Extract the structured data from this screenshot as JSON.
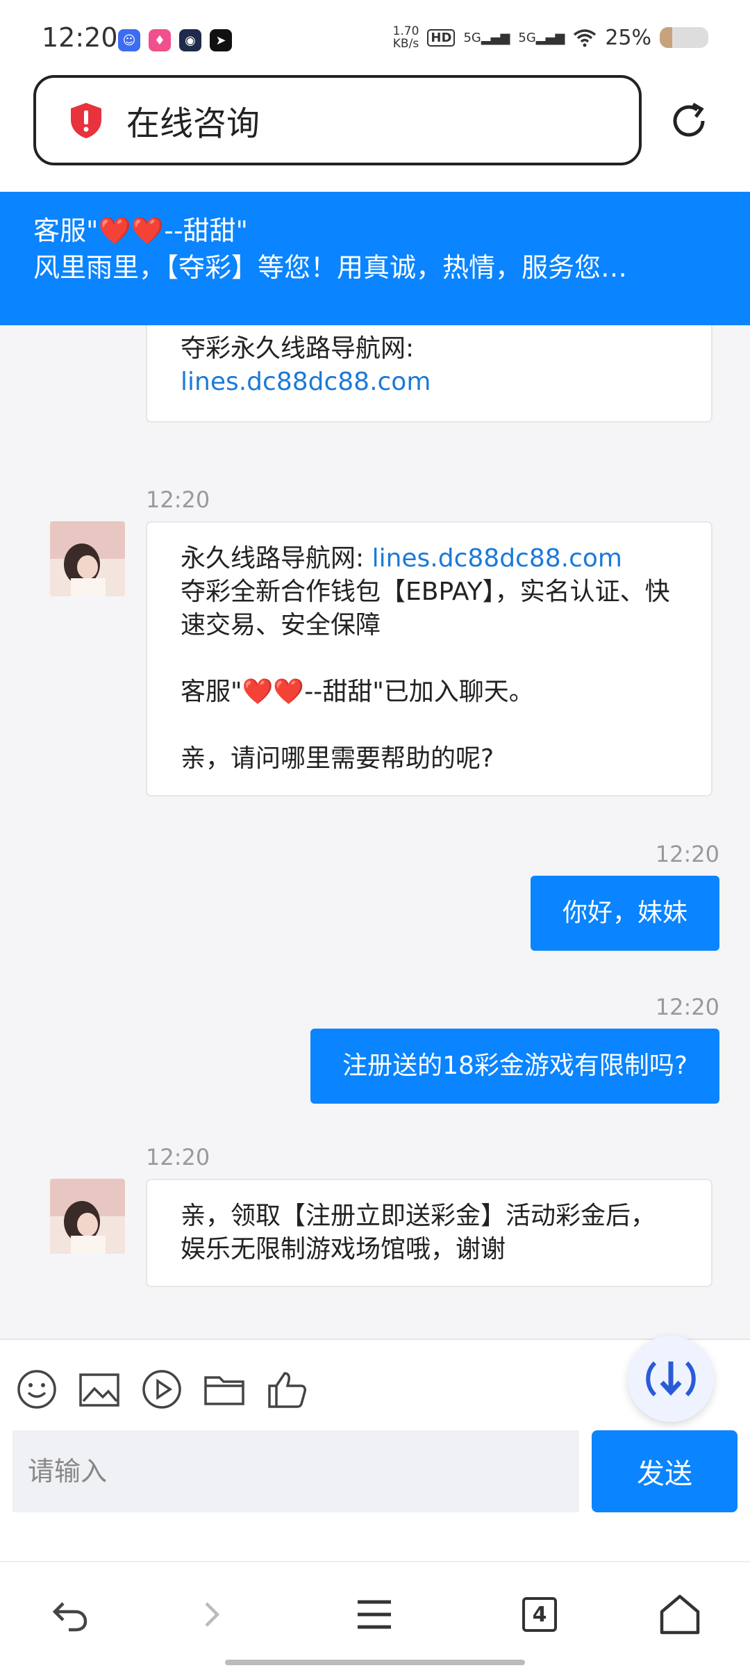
{
  "status": {
    "time": "12:20",
    "speed_value": "1.70",
    "speed_unit": "KB/s",
    "hd": "HD",
    "sim1": "5G",
    "sim2": "5G",
    "battery": "25%",
    "battery_level": 0.25
  },
  "browser": {
    "page_title": "在线咨询"
  },
  "header": {
    "agent_name": "客服\"❤️❤️--甜甜\"",
    "subtitle": "风里雨里，【夺彩】等您！用真诚，热情，服务您…"
  },
  "messages": [
    {
      "line1": "夺彩永久线路导航网:",
      "link": "lines.dc88dc88.com"
    },
    {
      "time": "12:20",
      "prefix": "永久线路导航网: ",
      "link": "lines.dc88dc88.com",
      "line2": "夺彩全新合作钱包【EBPAY】，实名认证、快速交易、安全保障",
      "line3": "客服\"❤️❤️--甜甜\"已加入聊天。",
      "line4": "亲，请问哪里需要帮助的呢?"
    },
    {
      "time": "12:20",
      "text": "你好，妹妹"
    },
    {
      "time": "12:20",
      "text": "注册送的18彩金游戏有限制吗?"
    },
    {
      "time": "12:20",
      "text": "亲，领取【注册立即送彩金】活动彩金后，娱乐无限制游戏场馆哦，谢谢"
    }
  ],
  "composer": {
    "placeholder": "请输入",
    "send_label": "发送"
  },
  "nav": {
    "tab_count": "4"
  },
  "colors": {
    "accent": "#0a84ff",
    "link": "#1a7ad9"
  },
  "icons": [
    "shield-alert-icon",
    "reload-icon",
    "emoji-icon",
    "image-icon",
    "video-icon",
    "folder-icon",
    "thumbs-up-icon",
    "download-float-icon",
    "back-icon",
    "forward-icon",
    "menu-icon",
    "tabs-icon",
    "home-icon"
  ]
}
